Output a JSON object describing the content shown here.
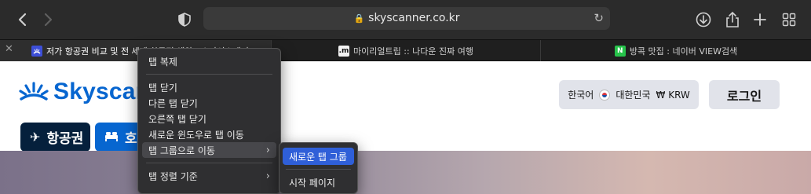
{
  "toolbar": {
    "back_icon": "chevron-left-icon",
    "forward_icon": "chevron-right-icon",
    "privacy_icon": "shield-icon",
    "url": "skyscanner.co.kr",
    "reload_icon": "reload-icon",
    "download_icon": "download-icon",
    "share_icon": "share-icon",
    "new_tab_icon": "plus-icon",
    "tab_overview_icon": "grid-icon"
  },
  "tabs": [
    {
      "label": "저가 항공권 비교 및 전 세계 항공편 예약 | 스카이스캐너",
      "favicon": "skyscanner-icon",
      "active": true
    },
    {
      "label": "마이리얼트립 :: 나다운 진짜 여행",
      "favicon": "myrealtrip-icon",
      "favicon_text": ".m",
      "active": false
    },
    {
      "label": "방콕 맛집 : 네이버 VIEW검색",
      "favicon": "naver-icon",
      "favicon_text": "N",
      "active": false
    }
  ],
  "page": {
    "logo_text": "Skyscanner",
    "locale": {
      "language": "한국어",
      "country": "대한민국",
      "currency": "₩ KRW"
    },
    "login_label": "로그인",
    "nav": [
      {
        "label": "항공권",
        "icon": "airplane-icon"
      },
      {
        "label": "호텔",
        "icon": "bed-icon"
      }
    ]
  },
  "context_menu": {
    "items": [
      {
        "label": "탭 복제"
      },
      {
        "label": "탭 닫기"
      },
      {
        "label": "다른 탭 닫기"
      },
      {
        "label": "오른쪽 탭 닫기"
      },
      {
        "label": "새로운 윈도우로 탭 이동"
      },
      {
        "label": "탭 그룹으로 이동",
        "submenu": true
      },
      {
        "label": "탭 정렬 기준",
        "submenu": true
      }
    ]
  },
  "submenu": {
    "items": [
      {
        "label": "새로운 탭 그룹",
        "selected": true
      },
      {
        "label": "시작 페이지"
      }
    ]
  },
  "colors": {
    "accent": "#0766d0",
    "flights_pill": "#05203c",
    "submenu_selected": "#2f5fd8"
  }
}
